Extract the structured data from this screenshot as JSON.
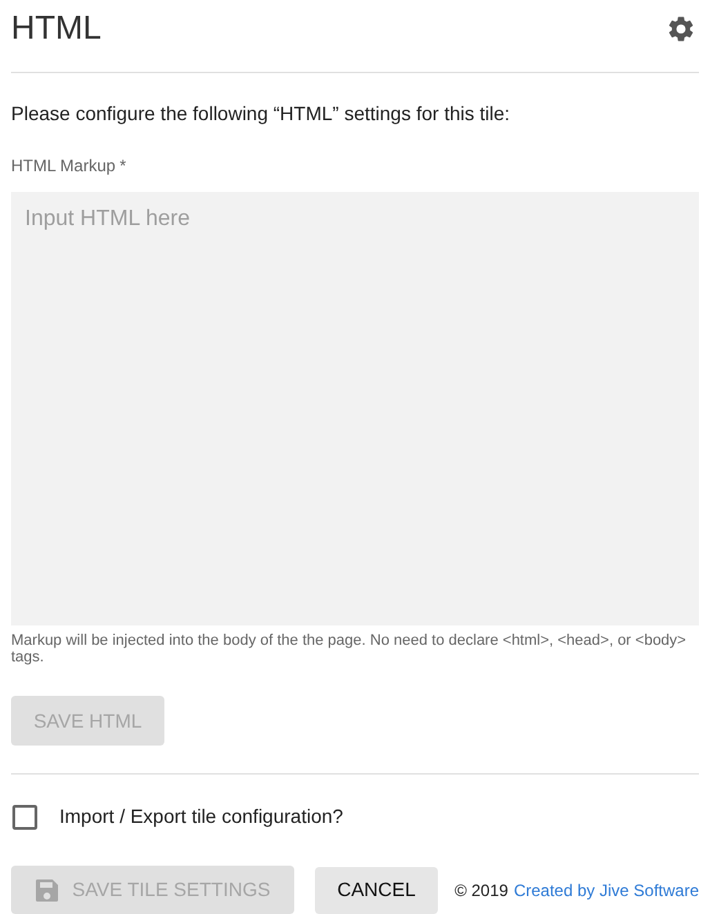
{
  "header": {
    "title": "HTML"
  },
  "intro": "Please configure the following “HTML” settings for this tile:",
  "markup_field": {
    "label": "HTML Markup",
    "required_mark": "*",
    "placeholder": "Input HTML here",
    "helper": "Markup will be injected into the body of the the page. No need to declare <html>, <head>, or <body> tags."
  },
  "save_html_button": {
    "label": "SAVE HTML",
    "disabled": true
  },
  "import_export": {
    "label": "Import / Export tile configuration?",
    "checked": false
  },
  "footer": {
    "save_button": {
      "label": "SAVE TILE SETTINGS",
      "disabled": true
    },
    "cancel_button": {
      "label": "CANCEL",
      "disabled": false
    },
    "copyright": "© 2019",
    "link": "Created by Jive Software"
  }
}
